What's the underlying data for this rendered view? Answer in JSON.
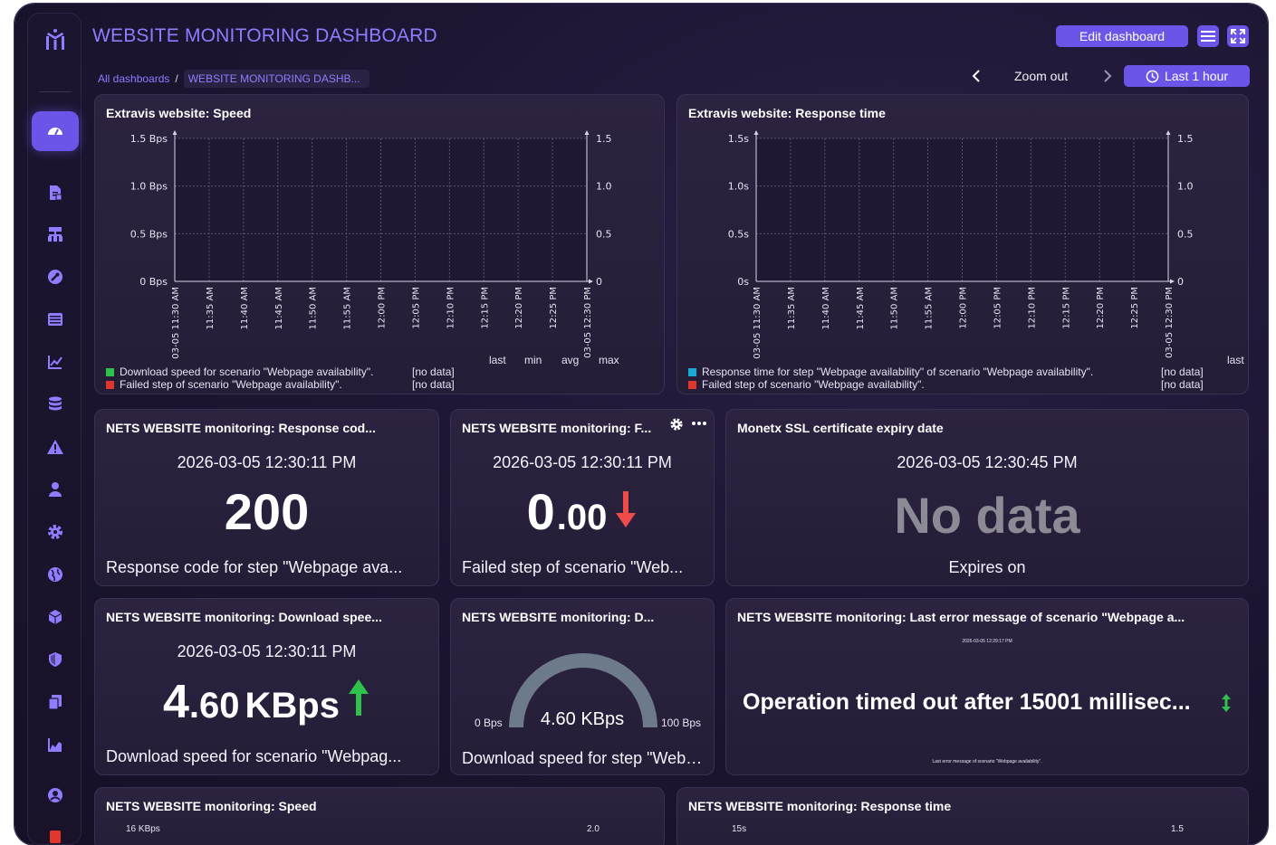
{
  "header": {
    "title": "WEBSITE MONITORING DASHBOARD",
    "edit_label": "Edit dashboard",
    "zoom_out_label": "Zoom out",
    "range_label": "Last 1 hour"
  },
  "breadcrumb": {
    "root": "All dashboards",
    "sep": "/",
    "current": "WEBSITE MONITORING DASHB..."
  },
  "sidebar": {
    "items": [
      "dashboard-icon",
      "report-icon",
      "topology-icon",
      "wrench-icon",
      "list-icon",
      "line-chart-icon",
      "database-icon",
      "alert-icon",
      "user-icon",
      "gear-icon",
      "globe-icon",
      "cube-icon",
      "shield-icon",
      "copy-icon",
      "area-chart-icon",
      "user-circle-icon"
    ]
  },
  "widgets": {
    "speed_chart": {
      "title": "Extravis website: Speed",
      "y_left": [
        "1.5 Bps",
        "1.0 Bps",
        "0.5 Bps",
        "0 Bps"
      ],
      "y_right": [
        "1.5",
        "1.0",
        "0.5",
        "0"
      ],
      "x_ticks": [
        "03-05 11:30 AM",
        "11:35 AM",
        "11:40 AM",
        "11:45 AM",
        "11:50 AM",
        "11:55 AM",
        "12:00 PM",
        "12:05 PM",
        "12:10 PM",
        "12:15 PM",
        "12:20 PM",
        "12:25 PM",
        "03-05 12:30 PM"
      ],
      "legend_head": {
        "last": "last",
        "min": "min",
        "avg": "avg",
        "max": "max"
      },
      "legend": [
        {
          "label": "Download speed for scenario \"Webpage availability\".",
          "value": "[no data]",
          "color": "#2ec24a"
        },
        {
          "label": "Failed step of scenario \"Webpage availability\".",
          "value": "[no data]",
          "color": "#e0362c"
        }
      ]
    },
    "response_chart": {
      "title": "Extravis website: Response time",
      "y_left": [
        "1.5s",
        "1.0s",
        "0.5s",
        "0s"
      ],
      "y_right": [
        "1.5",
        "1.0",
        "0.5",
        "0"
      ],
      "x_ticks": [
        "03-05 11:30 AM",
        "11:35 AM",
        "11:40 AM",
        "11:45 AM",
        "11:50 AM",
        "11:55 AM",
        "12:00 PM",
        "12:05 PM",
        "12:10 PM",
        "12:15 PM",
        "12:20 PM",
        "12:25 PM",
        "03-05 12:30 PM"
      ],
      "legend_head": {
        "last": "last"
      },
      "legend": [
        {
          "label": "Response time for step \"Webpage availability\" of scenario \"Webpage availability\".",
          "value": "[no data]",
          "color": "#1aa9d6"
        },
        {
          "label": "Failed step of scenario \"Webpage availability\".",
          "value": "[no data]",
          "color": "#e0362c"
        }
      ]
    },
    "response_code": {
      "title": "NETS WEBSITE monitoring: Response cod...",
      "time": "2026-03-05 12:30:11 PM",
      "value": "200",
      "desc": "Response code for step \"Webpage ava..."
    },
    "failed_step": {
      "title": "NETS WEBSITE monitoring: F...",
      "time": "2026-03-05 12:30:11 PM",
      "value_int": "0",
      "value_dec": ".00",
      "desc": "Failed step of scenario \"Web..."
    },
    "ssl_expiry": {
      "title": "Monetx SSL certificate expiry date",
      "time": "2026-03-05 12:30:45 PM",
      "value": "No data",
      "desc": "Expires on"
    },
    "download_speed": {
      "title": "NETS WEBSITE monitoring: Download spee...",
      "time": "2026-03-05 12:30:11 PM",
      "value_int": "4",
      "value_dec": ".60",
      "unit": "KBps",
      "desc": "Download speed for scenario \"Webpag..."
    },
    "gauge": {
      "title": "NETS WEBSITE monitoring: D...",
      "value": "4.60 KBps",
      "min": "0 Bps",
      "max": "100 Bps",
      "level": 1.0,
      "desc": "Download speed for step \"Webp..."
    },
    "last_error": {
      "title": "NETS WEBSITE monitoring: Last error message of scenario \"Webpage a...",
      "time": "2026-03-05 12:29:17 PM",
      "value": "Operation timed out after 15001 millisec...",
      "desc": "Last error message of scenario \"Webpage availability\"."
    },
    "bottom_speed": {
      "title": "NETS WEBSITE monitoring: Speed",
      "y_top_left": "16 KBps",
      "y_top_right": "2.0"
    },
    "bottom_response": {
      "title": "NETS WEBSITE monitoring: Response time",
      "y_top_left": "15s",
      "y_top_right": "1.5"
    }
  },
  "colors": {
    "accent": "#6b55e8",
    "title": "#8f7cff",
    "up_arrow": "#2ec24a",
    "down_arrow": "#f04b4b",
    "gauge_track": "#6d7a8a"
  }
}
